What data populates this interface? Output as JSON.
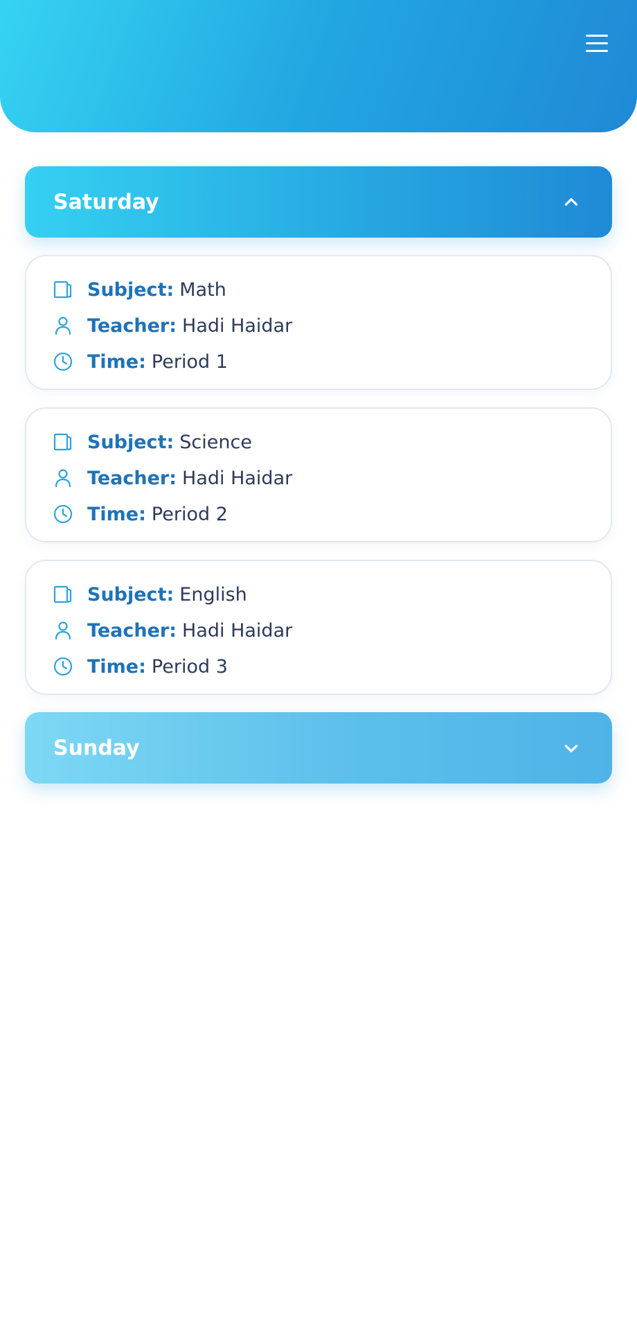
{
  "header": {
    "menu_icon": "hamburger-menu-icon"
  },
  "days": [
    {
      "name": "Saturday",
      "expanded": true,
      "lessons": [
        {
          "subject_label": "Subject:",
          "subject": "Math",
          "teacher_label": "Teacher:",
          "teacher": "Hadi Haidar",
          "time_label": "Time:",
          "time": "Period 1"
        },
        {
          "subject_label": "Subject:",
          "subject": "Science",
          "teacher_label": "Teacher:",
          "teacher": "Hadi Haidar",
          "time_label": "Time:",
          "time": "Period 2"
        },
        {
          "subject_label": "Subject:",
          "subject": "English",
          "teacher_label": "Teacher:",
          "teacher": "Hadi Haidar",
          "time_label": "Time:",
          "time": "Period 3"
        }
      ]
    },
    {
      "name": "Sunday",
      "expanded": false
    }
  ],
  "colors": {
    "accent": "#22a6e1",
    "label": "#1e73b8",
    "text": "#2d3a5a",
    "icon": "#2ea3dc"
  },
  "icons": {
    "subject": "book-icon",
    "teacher": "user-icon",
    "time": "clock-icon"
  }
}
